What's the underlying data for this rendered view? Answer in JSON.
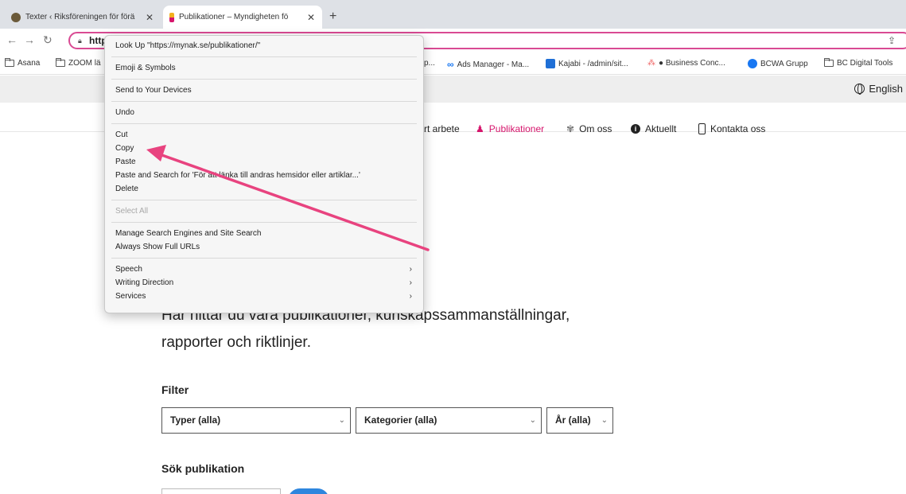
{
  "browser": {
    "tabs": [
      {
        "title": "Texter ‹ Riksföreningen för förä",
        "active": false
      },
      {
        "title": "Publikationer – Myndigheten fö",
        "active": true
      }
    ],
    "new_tab": "+",
    "url_visible": "http",
    "bookmarks": [
      {
        "label": "Asana",
        "icon": "folder-icon"
      },
      {
        "label": "ZOOM lä",
        "icon": "folder-icon"
      },
      {
        "label": "p...",
        "icon": "page-icon"
      },
      {
        "label": "Ads Manager - Ma...",
        "icon": "meta-icon"
      },
      {
        "label": "Kajabi - /admin/sit...",
        "icon": "kajabi-icon"
      },
      {
        "label": "● Business Conc...",
        "icon": "asana-icon"
      },
      {
        "label": "BCWA Grupp",
        "icon": "facebook-icon"
      },
      {
        "label": "BC Digital Tools",
        "icon": "folder-icon"
      }
    ]
  },
  "site": {
    "language": "English",
    "nav": [
      {
        "label": "rt arbete",
        "active": false
      },
      {
        "label": "Publikationer",
        "active": true
      },
      {
        "label": "Om oss",
        "active": false
      },
      {
        "label": "Aktuellt",
        "active": false
      },
      {
        "label": "Kontakta oss",
        "active": false
      }
    ],
    "intro_line1": "Här hittar du våra publikationer, kunskapssammanställningar,",
    "intro_line2": "rapporter och riktlinjer.",
    "filter_title": "Filter",
    "filters": [
      {
        "label": "Typer (alla)"
      },
      {
        "label": "Kategorier (alla)"
      },
      {
        "label": "År (alla)"
      }
    ],
    "search_title": "Sök publikation"
  },
  "context_menu": {
    "look_up": "Look Up \"https://mynak.se/publikationer/\"",
    "emoji": "Emoji & Symbols",
    "send": "Send to Your Devices",
    "undo": "Undo",
    "cut": "Cut",
    "copy": "Copy",
    "paste": "Paste",
    "paste_search": "Paste and Search for 'För att länka till andras hemsidor eller artiklar...'",
    "delete": "Delete",
    "select_all": "Select All",
    "manage_search": "Manage Search Engines and Site Search",
    "show_urls": "Always Show Full URLs",
    "speech": "Speech",
    "writing_direction": "Writing Direction",
    "services": "Services",
    "submenu_arrow": "›"
  },
  "annotation": {
    "color": "#e8437f"
  },
  "colors": {
    "accent": "#d6156c",
    "omnibox_border": "#d94a93",
    "button": "#2e86de"
  }
}
